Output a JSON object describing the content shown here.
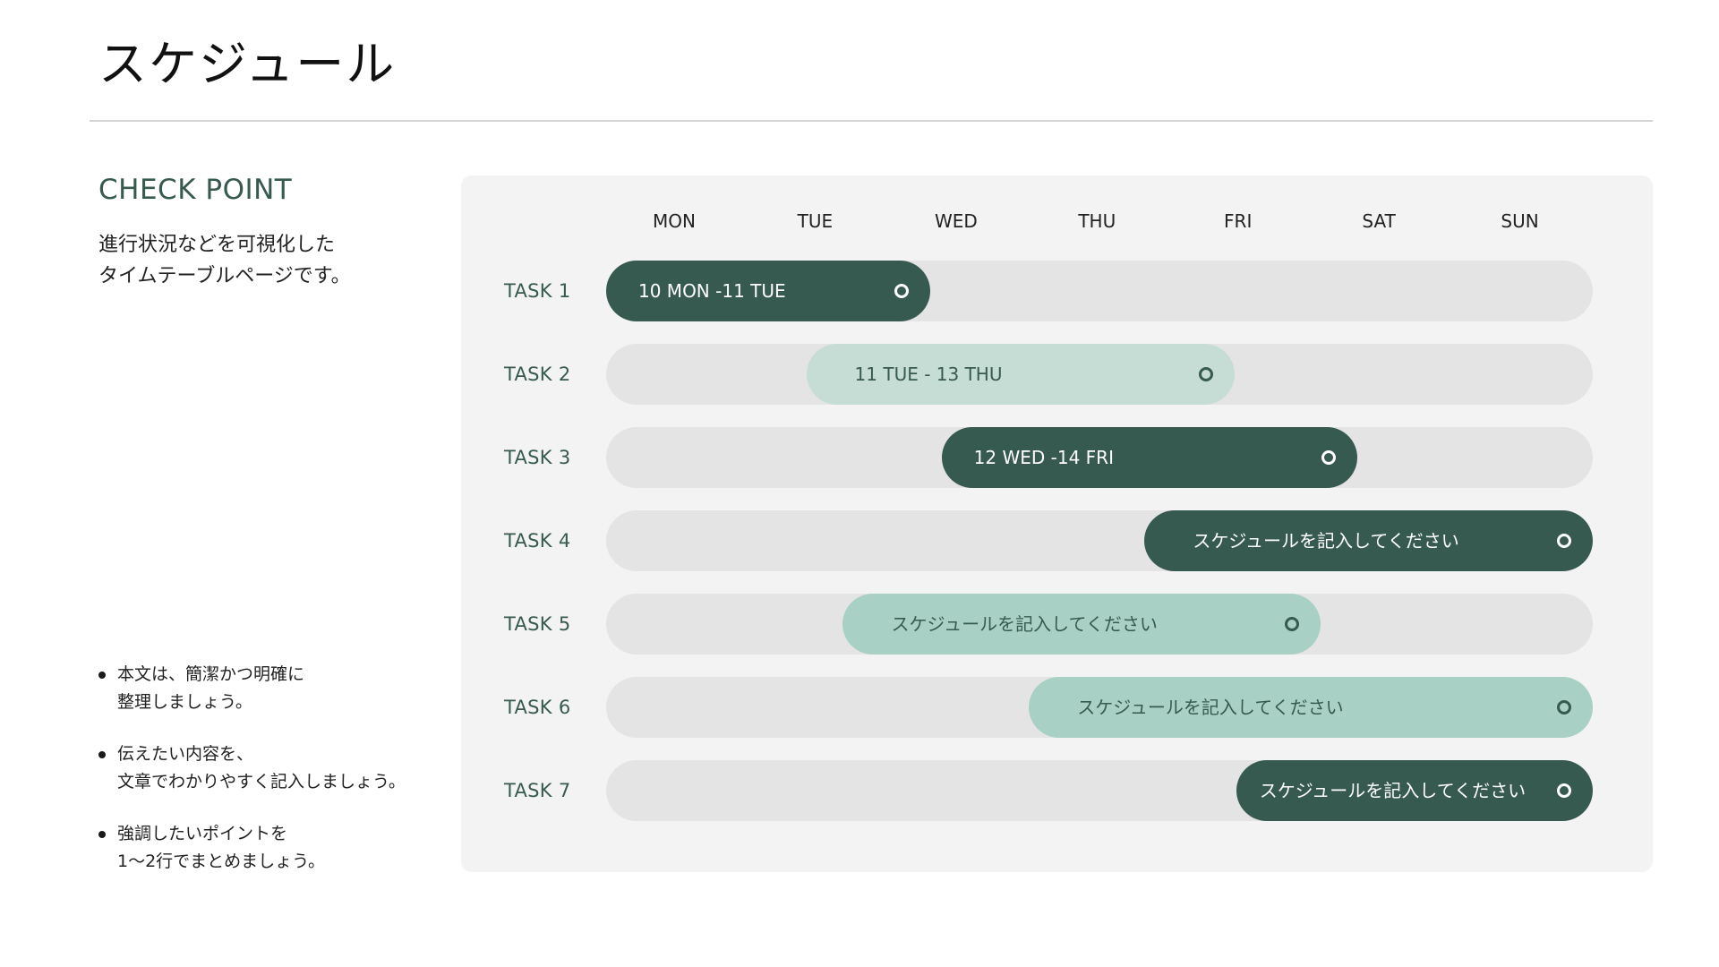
{
  "page": {
    "title": "スケジュール"
  },
  "check_point": {
    "heading": "CHECK POINT",
    "description": "進行状況などを可視化した\nタイムテーブルページです。",
    "bullets": [
      "本文は、簡潔かつ明確に\n整理しましょう。",
      "伝えたい内容を、\n文章でわかりやすく記入しましょう。",
      "強調したいポイントを\n1〜2行でまとめましょう。"
    ]
  },
  "schedule": {
    "days": [
      "MON",
      "TUE",
      "WED",
      "THU",
      "FRI",
      "SAT",
      "SUN"
    ],
    "colors": {
      "dark": "#375a50",
      "light": "#c5ddd4",
      "medium": "#a9d0c4",
      "track": "#e4e4e4",
      "panel": "#f3f3f3"
    },
    "tasks": [
      {
        "label": "TASK 1",
        "text": "10 MON -11 TUE",
        "start_day": 0.0,
        "end_day": 2.3,
        "style": "dark"
      },
      {
        "label": "TASK 2",
        "text": "11 TUE - 13 THU",
        "start_day": 1.42,
        "end_day": 4.46,
        "style": "light"
      },
      {
        "label": "TASK 3",
        "text": "12 WED -14 FRI",
        "start_day": 2.38,
        "end_day": 5.33,
        "style": "dark"
      },
      {
        "label": "TASK 4",
        "text": "スケジュールを記入してください",
        "start_day": 3.82,
        "end_day": 7.0,
        "style": "dark"
      },
      {
        "label": "TASK 5",
        "text": "スケジュールを記入してください",
        "start_day": 1.68,
        "end_day": 5.07,
        "style": "medium"
      },
      {
        "label": "TASK 6",
        "text": "スケジュールを記入してください",
        "start_day": 3.0,
        "end_day": 7.0,
        "style": "medium"
      },
      {
        "label": "TASK 7",
        "text": "スケジュールを記入してください",
        "start_day": 4.47,
        "end_day": 7.0,
        "style": "dark"
      }
    ]
  }
}
